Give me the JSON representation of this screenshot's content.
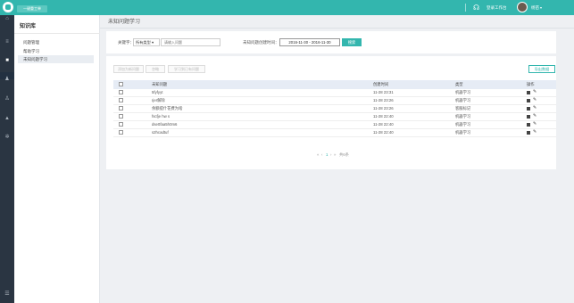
{
  "topbar": {
    "button_label": "一键重工单",
    "workspace_label": "登录工作台",
    "workspace_icon": "headset-icon",
    "username": "杨苗",
    "caret": "▾",
    "accent": "#33b6ae"
  },
  "leftbar": {
    "icons": [
      "home-icon",
      "list-icon",
      "book-icon",
      "user-icon",
      "person-icon",
      "chart-icon",
      "gear-icon",
      "menu-icon"
    ]
  },
  "sidebar": {
    "title": "知识库",
    "items": [
      {
        "label": "问题管理"
      },
      {
        "label": "帮助学习"
      },
      {
        "label": "未知问题学习"
      }
    ]
  },
  "page": {
    "title": "未知问题学习"
  },
  "filters": {
    "keyword_label": "关键字：",
    "type_select": "所有类型",
    "select_arrow": "▾",
    "keyword_placeholder": "请输入问题",
    "date_label": "未知问题创建时间：",
    "date_range": "2016-11-30 - 2016-11-30",
    "search_button": "搜索"
  },
  "toolbar": {
    "batch_add": "添加为新问题",
    "ignore": "忽略",
    "learn_existing": "学习到已有问题",
    "export": "导出数据"
  },
  "table": {
    "headers": [
      "未知问题",
      "创建时间",
      "类型",
      "操作"
    ],
    "rows": [
      {
        "question": "5fyfyyt",
        "time": "11-28 23:31",
        "type": "机器学习"
      },
      {
        "question": "rjer解除",
        "time": "11-28 23:26",
        "type": "机器学习"
      },
      {
        "question": "余额提什花费为啥",
        "time": "11-28 23:26",
        "type": "客服标记"
      },
      {
        "question": "fscfje hw s",
        "time": "11-28 22:40",
        "type": "机器学习"
      },
      {
        "question": "dse0faa5h0m6",
        "time": "11-28 22:40",
        "type": "机器学习"
      },
      {
        "question": "s2hcadtuf",
        "time": "11-28 22:40",
        "type": "机器学习"
      }
    ]
  },
  "pagination": {
    "prev2": "«",
    "prev": "‹",
    "current": "1",
    "next": "›",
    "next2": "»",
    "total": "共6条"
  }
}
